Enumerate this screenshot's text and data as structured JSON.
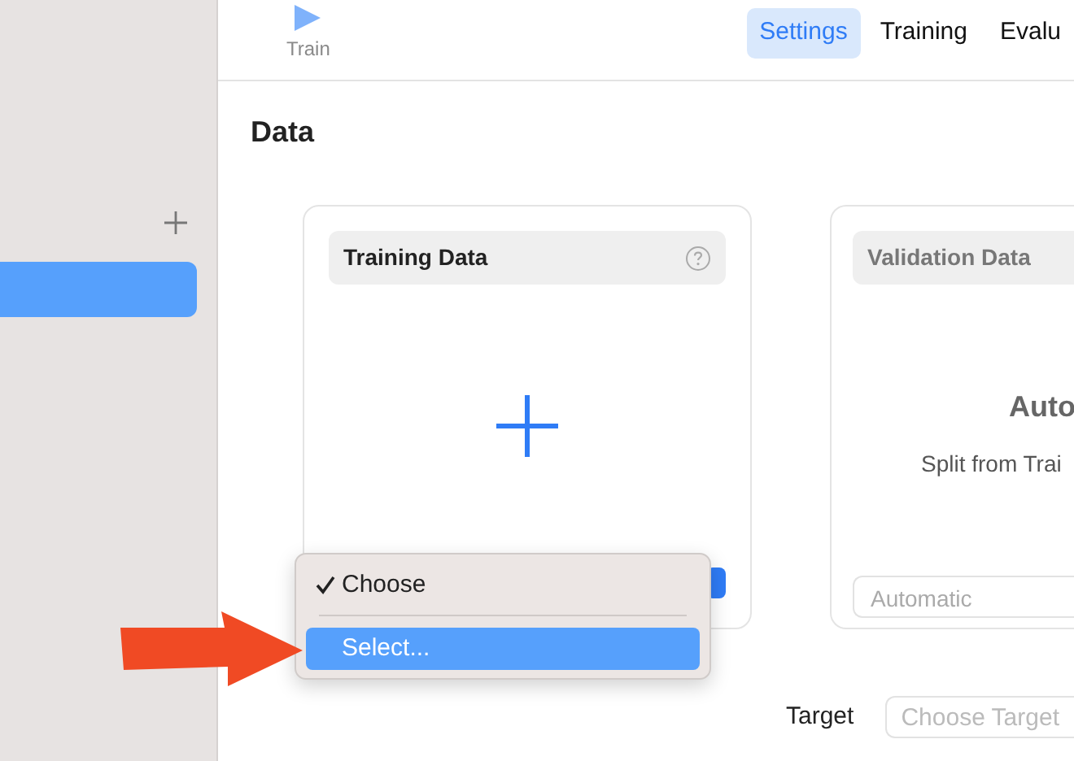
{
  "sidebar": {
    "items": [
      {
        "selected": true
      }
    ]
  },
  "toolbar": {
    "run": {
      "label": "Train"
    },
    "tabs": [
      {
        "label": "Settings",
        "selected": true
      },
      {
        "label": "Training",
        "selected": false
      },
      {
        "label": "Evalu",
        "selected": false
      }
    ]
  },
  "section": {
    "title": "Data"
  },
  "cards": [
    {
      "kind": "drop",
      "title": "Training Data"
    },
    {
      "kind": "auto",
      "title": "Validation Data",
      "heading": "Auto",
      "subtitle": "Split from Trai",
      "field": {
        "value": "Automatic",
        "disabled": true
      }
    }
  ],
  "menu": {
    "items": [
      {
        "label": "Choose",
        "checked": true,
        "selected": false
      },
      {
        "label": "Select...",
        "checked": false,
        "selected": true
      }
    ]
  },
  "target": {
    "label": "Target",
    "placeholder": "Choose Target"
  }
}
